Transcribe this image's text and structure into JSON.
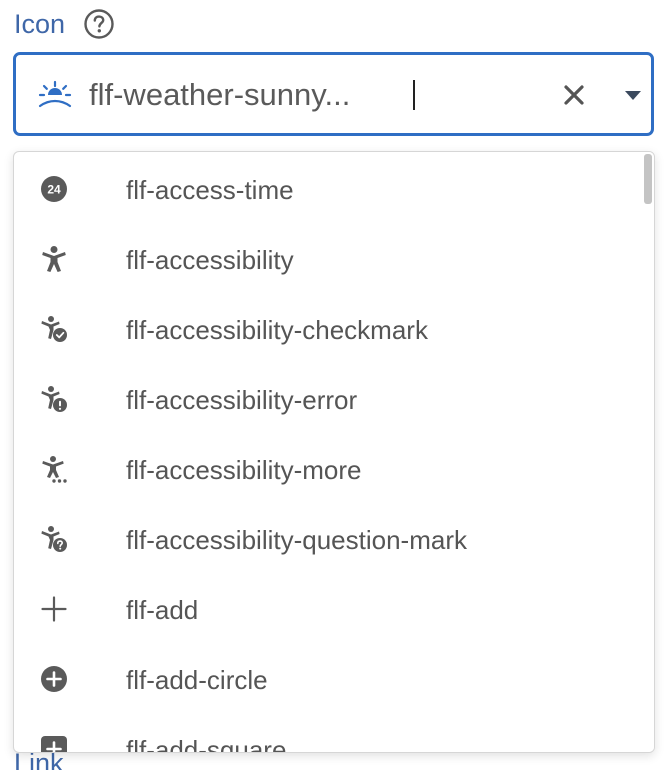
{
  "field": {
    "label": "Icon",
    "next_label": "Link"
  },
  "select": {
    "value": "flf-weather-sunny...",
    "selected_icon": "weather-sunny-icon",
    "clear_icon": "close-icon",
    "toggle_icon": "caret-down-icon"
  },
  "options": [
    {
      "label": "flf-access-time",
      "icon": "access-time-icon"
    },
    {
      "label": "flf-accessibility",
      "icon": "accessibility-icon"
    },
    {
      "label": "flf-accessibility-checkmark",
      "icon": "accessibility-checkmark-icon"
    },
    {
      "label": "flf-accessibility-error",
      "icon": "accessibility-error-icon"
    },
    {
      "label": "flf-accessibility-more",
      "icon": "accessibility-more-icon"
    },
    {
      "label": "flf-accessibility-question-mark",
      "icon": "accessibility-question-mark-icon"
    },
    {
      "label": "flf-add",
      "icon": "add-icon"
    },
    {
      "label": "flf-add-circle",
      "icon": "add-circle-icon"
    },
    {
      "label": "flf-add-square",
      "icon": "add-square-icon"
    }
  ],
  "colors": {
    "label": "#3f67a8",
    "focus_border": "#2f6ec4",
    "icon": "#5a5a5a",
    "option_text": "#555555"
  }
}
